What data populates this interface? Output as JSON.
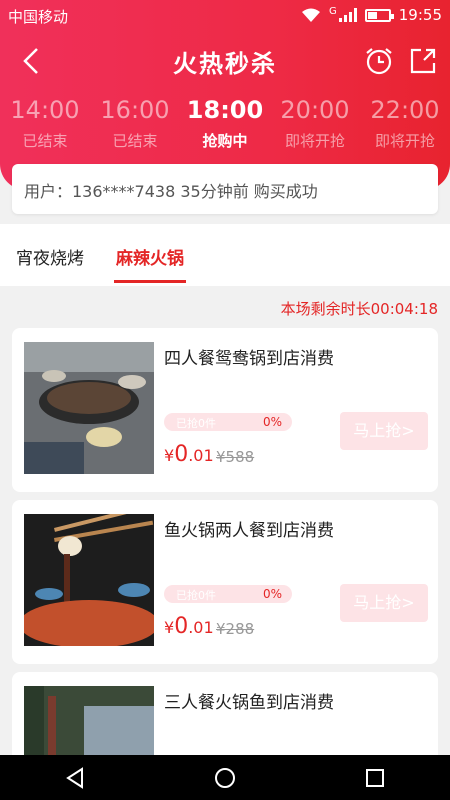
{
  "status": {
    "carrier": "中国移动",
    "time": "19:55",
    "network_label": "G"
  },
  "header": {
    "title": "火热秒杀"
  },
  "time_slots": [
    {
      "time": "14:00",
      "label": "已结束"
    },
    {
      "time": "16:00",
      "label": "已结束"
    },
    {
      "time": "18:00",
      "label": "抢购中"
    },
    {
      "time": "20:00",
      "label": "即将开抢"
    },
    {
      "time": "22:00",
      "label": "即将开抢"
    }
  ],
  "ticker": "用户：136****7438  35分钟前 购买成功",
  "tabs": [
    "宵夜烧烤",
    "麻辣火锅"
  ],
  "remaining_time": "本场剩余时长00:04:18",
  "products": [
    {
      "name": "四人餐鸳鸯锅到店消费",
      "sold": "已抢0件",
      "percent": "0%",
      "currency": "¥",
      "price_int": "0",
      "price_dec": ".01",
      "original": "¥588",
      "button": "马上抢>"
    },
    {
      "name": "鱼火锅两人餐到店消费",
      "sold": "已抢0件",
      "percent": "0%",
      "currency": "¥",
      "price_int": "0",
      "price_dec": ".01",
      "original": "¥288",
      "button": "马上抢>"
    },
    {
      "name": "三人餐火锅鱼到店消费"
    }
  ],
  "colors": {
    "accent": "#e42626",
    "header_gradient_start": "#f0305a",
    "header_gradient_end": "#e8232f",
    "progress_bg": "#fde3e6"
  },
  "icons": {
    "back": "chevron-left-icon",
    "alarm": "alarm-clock-icon",
    "share": "share-icon",
    "nav_back": "triangle-back-icon",
    "nav_home": "circle-home-icon",
    "nav_recent": "square-recent-icon"
  }
}
